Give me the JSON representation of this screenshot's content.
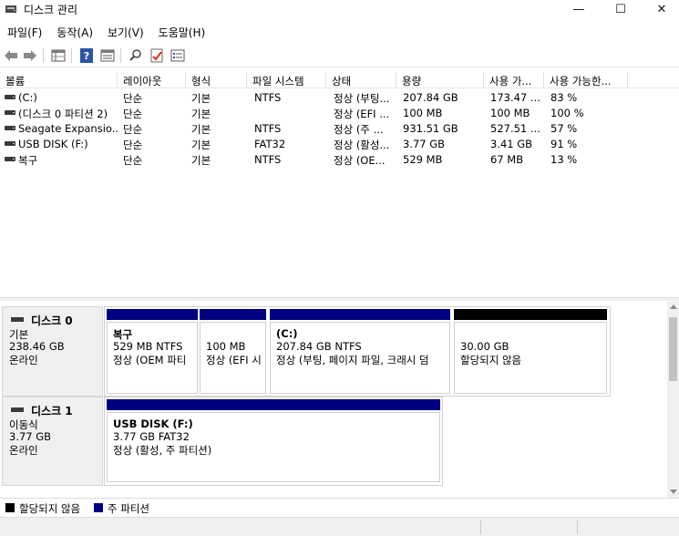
{
  "window": {
    "title": "디스크 관리",
    "minimize": "—",
    "maximize": "☐",
    "close": "✕"
  },
  "menu": [
    "파일(F)",
    "동작(A)",
    "보기(V)",
    "도움말(H)"
  ],
  "toolbar": {
    "icons": [
      "back-arrow-icon",
      "forward-arrow-icon",
      "properties-grid-icon",
      "help-icon",
      "refresh-list-icon",
      "rescan-disk-icon",
      "checklist-icon",
      "settings-list-icon"
    ]
  },
  "volume_list": {
    "columns": [
      "볼륨",
      "레이아웃",
      "형식",
      "파일 시스템",
      "상태",
      "용량",
      "사용 가...",
      "사용 가능한..."
    ],
    "rows": [
      [
        "(C:)",
        "단순",
        "기본",
        "NTFS",
        "정상 (부팅...",
        "207.84 GB",
        "173.47 ...",
        "83 %"
      ],
      [
        "(디스크 0 파티션 2)",
        "단순",
        "기본",
        "",
        "정상 (EFI ...",
        "100 MB",
        "100 MB",
        "100 %"
      ],
      [
        "Seagate Expansio...",
        "단순",
        "기본",
        "NTFS",
        "정상 (주 ...",
        "931.51 GB",
        "527.51 ...",
        "57 %"
      ],
      [
        "USB DISK (F:)",
        "단순",
        "기본",
        "FAT32",
        "정상 (활성...",
        "3.77 GB",
        "3.41 GB",
        "91 %"
      ],
      [
        "복구",
        "단순",
        "기본",
        "NTFS",
        "정상 (OE...",
        "529 MB",
        "67 MB",
        "13 %"
      ]
    ]
  },
  "disks": [
    {
      "name": "디스크 0",
      "type": "기본",
      "size": "238.46 GB",
      "status": "온라인",
      "partitions": [
        {
          "title": "복구",
          "line1": "529 MB NTFS",
          "line2": "정상 (OEM 파티",
          "kind": "primary"
        },
        {
          "title": "",
          "line1": "100 MB",
          "line2": "정상 (EFI 시",
          "kind": "primary"
        },
        {
          "title": "(C:)",
          "line1": "207.84 GB NTFS",
          "line2": "정상 (부팅, 페이지 파일, 크래시 덤",
          "kind": "primary"
        },
        {
          "title": "",
          "line1": "30.00 GB",
          "line2": "할당되지 않음",
          "kind": "unallocated"
        }
      ]
    },
    {
      "name": "디스크 1",
      "type": "이동식",
      "size": "3.77 GB",
      "status": "온라인",
      "partitions": [
        {
          "title": "USB DISK  (F:)",
          "line1": "3.77 GB FAT32",
          "line2": "정상 (활성, 주 파티션)",
          "kind": "primary"
        }
      ]
    }
  ],
  "legend": [
    {
      "label": "할당되지 않음",
      "color": "#000000"
    },
    {
      "label": "주 파티션",
      "color": "#000080"
    }
  ],
  "colors": {
    "primary": "#000080",
    "unallocated": "#000000"
  }
}
